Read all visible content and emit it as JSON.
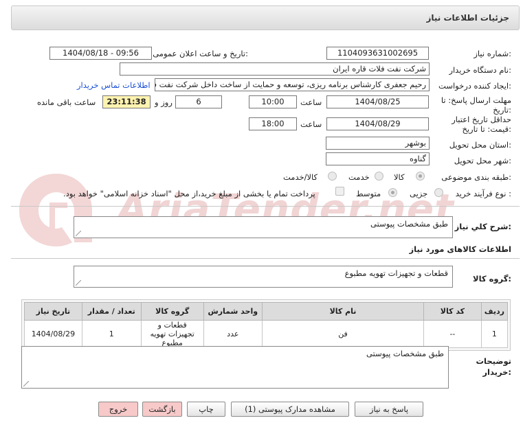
{
  "header": {
    "title": "جزئیات اطلاعات نیاز"
  },
  "watermark": {
    "text": "AriaTender.net",
    "color": "#f1d4d4",
    "logo_color": "#f3d6d6"
  },
  "form": {
    "need_number": {
      "label": "شماره نیاز:",
      "value": "1104093631002695"
    },
    "announce_datetime": {
      "label": "تاریخ و ساعت اعلان عمومی:",
      "value": "1404/08/18 - 09:56"
    },
    "buyer_org": {
      "label": "نام دستگاه خریدار:",
      "value": "شرکت نفت فلات قاره ایران"
    },
    "requester": {
      "label": "ایجاد کننده درخواست:",
      "value": "رحیم جعفری کارشناس برنامه ریزی، توسعه و حمایت از ساخت داخل شرکت نفت فلات قاره ایران",
      "contact_link": "اطلاعات تماس خریدار"
    },
    "deadline": {
      "label_line1": "مهلت ارسال پاسخ: تا",
      "label_line2": "تاریخ:",
      "date": "1404/08/25",
      "time_label": "ساعت",
      "time": "10:00",
      "days": "6",
      "days_label": "روز و",
      "remaining": "23:11:38",
      "remaining_label": "ساعت باقی مانده"
    },
    "price_validity": {
      "label_line1": "حداقل تاریخ اعتبار",
      "label_line2": "قیمت: تا تاریخ:",
      "date": "1404/08/29",
      "time_label": "ساعت",
      "time": "18:00"
    },
    "province": {
      "label": "استان محل تحویل:",
      "value": "بوشهر"
    },
    "city": {
      "label": "شهر محل تحویل:",
      "value": "گناوه"
    },
    "category": {
      "label": "طبقه بندی موضوعی:",
      "options": [
        "کالا",
        "خدمت",
        "کالا/خدمت"
      ],
      "selected": "کالا"
    },
    "purchase_process": {
      "label": "نوع فرآیند خرید :",
      "options": [
        "جزیی",
        "متوسط"
      ],
      "selected": "متوسط",
      "payment_note": "پرداخت تمام یا بخشی از مبلغ خرید،از محل \"اسناد خزانه اسلامی\" خواهد بود."
    }
  },
  "description": {
    "label": "شرح كلي نياز:",
    "value": "طبق مشخصات پیوستی"
  },
  "goods_section": {
    "title": "اطلاعات کالاهای مورد نیاز",
    "group_label": "گروه کالا:",
    "group_value": "قطعات و تجهیزات تهویه مطبوع"
  },
  "table": {
    "headers": [
      "ردیف",
      "کد کالا",
      "نام کالا",
      "واحد شمارش",
      "گروه کالا",
      "تعداد / مقدار",
      "تاریخ نیاز"
    ],
    "rows": [
      {
        "row": "1",
        "code": "--",
        "name": "فن",
        "unit": "عدد",
        "group": "قطعات و تجهیزات تهویه مطبوع",
        "qty": "1",
        "date": "1404/08/29"
      }
    ]
  },
  "buyer_notes": {
    "label_line1": "توضیحات",
    "label_line2": "خریدار:",
    "value": "طبق مشخصات پیوستی"
  },
  "buttons": {
    "reply": "پاسخ به نیاز",
    "view_docs": "مشاهده مدارک پیوستی (1)",
    "print": "چاپ",
    "back": "بازگشت",
    "exit": "خروج",
    "pink_color": "#f7c9c9"
  }
}
